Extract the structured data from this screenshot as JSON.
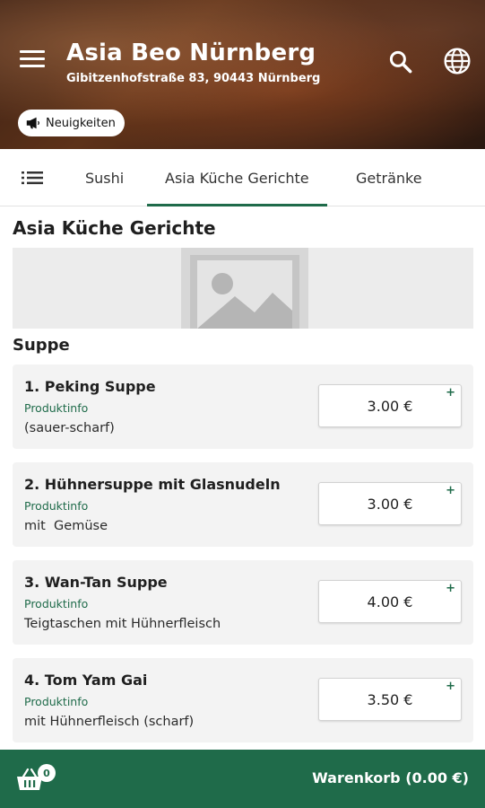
{
  "header": {
    "title": "Asia Beo Nürnberg",
    "address": "Gibitzenhofstraße 83, 90443 Nürnberg",
    "news_label": "Neuigkeiten",
    "icons": [
      "menu-icon",
      "search-icon",
      "globe-icon",
      "megaphone-icon"
    ]
  },
  "tabs": [
    {
      "label": "Sushi"
    },
    {
      "label": "Asia Küche Gerichte"
    },
    {
      "label": "Getränke"
    }
  ],
  "main": {
    "section_title": "Asia Küche Gerichte",
    "subsection_title": "Suppe",
    "items": [
      {
        "name": "1. Peking Suppe",
        "info": "Produktinfo",
        "description": "(sauer-scharf)",
        "price": "3.00 €",
        "add": "+"
      },
      {
        "name": "2. Hühnersuppe mit Glasnudeln",
        "info": "Produktinfo",
        "description": "mit  Gemüse",
        "price": "3.00 €",
        "add": "+"
      },
      {
        "name": "3. Wan-Tan Suppe",
        "info": "Produktinfo",
        "description": "Teigtaschen mit Hühnerfleisch",
        "price": "4.00 €",
        "add": "+"
      },
      {
        "name": "4. Tom Yam Gai",
        "info": "Produktinfo",
        "description": "mit Hühnerfleisch (scharf)",
        "price": "3.50 €",
        "add": "+"
      }
    ]
  },
  "cart": {
    "count": "0",
    "label": "Warenkorb (0.00 €)"
  },
  "colors": {
    "accent": "#1f6b4a",
    "card_bg": "#f3f3f3"
  }
}
